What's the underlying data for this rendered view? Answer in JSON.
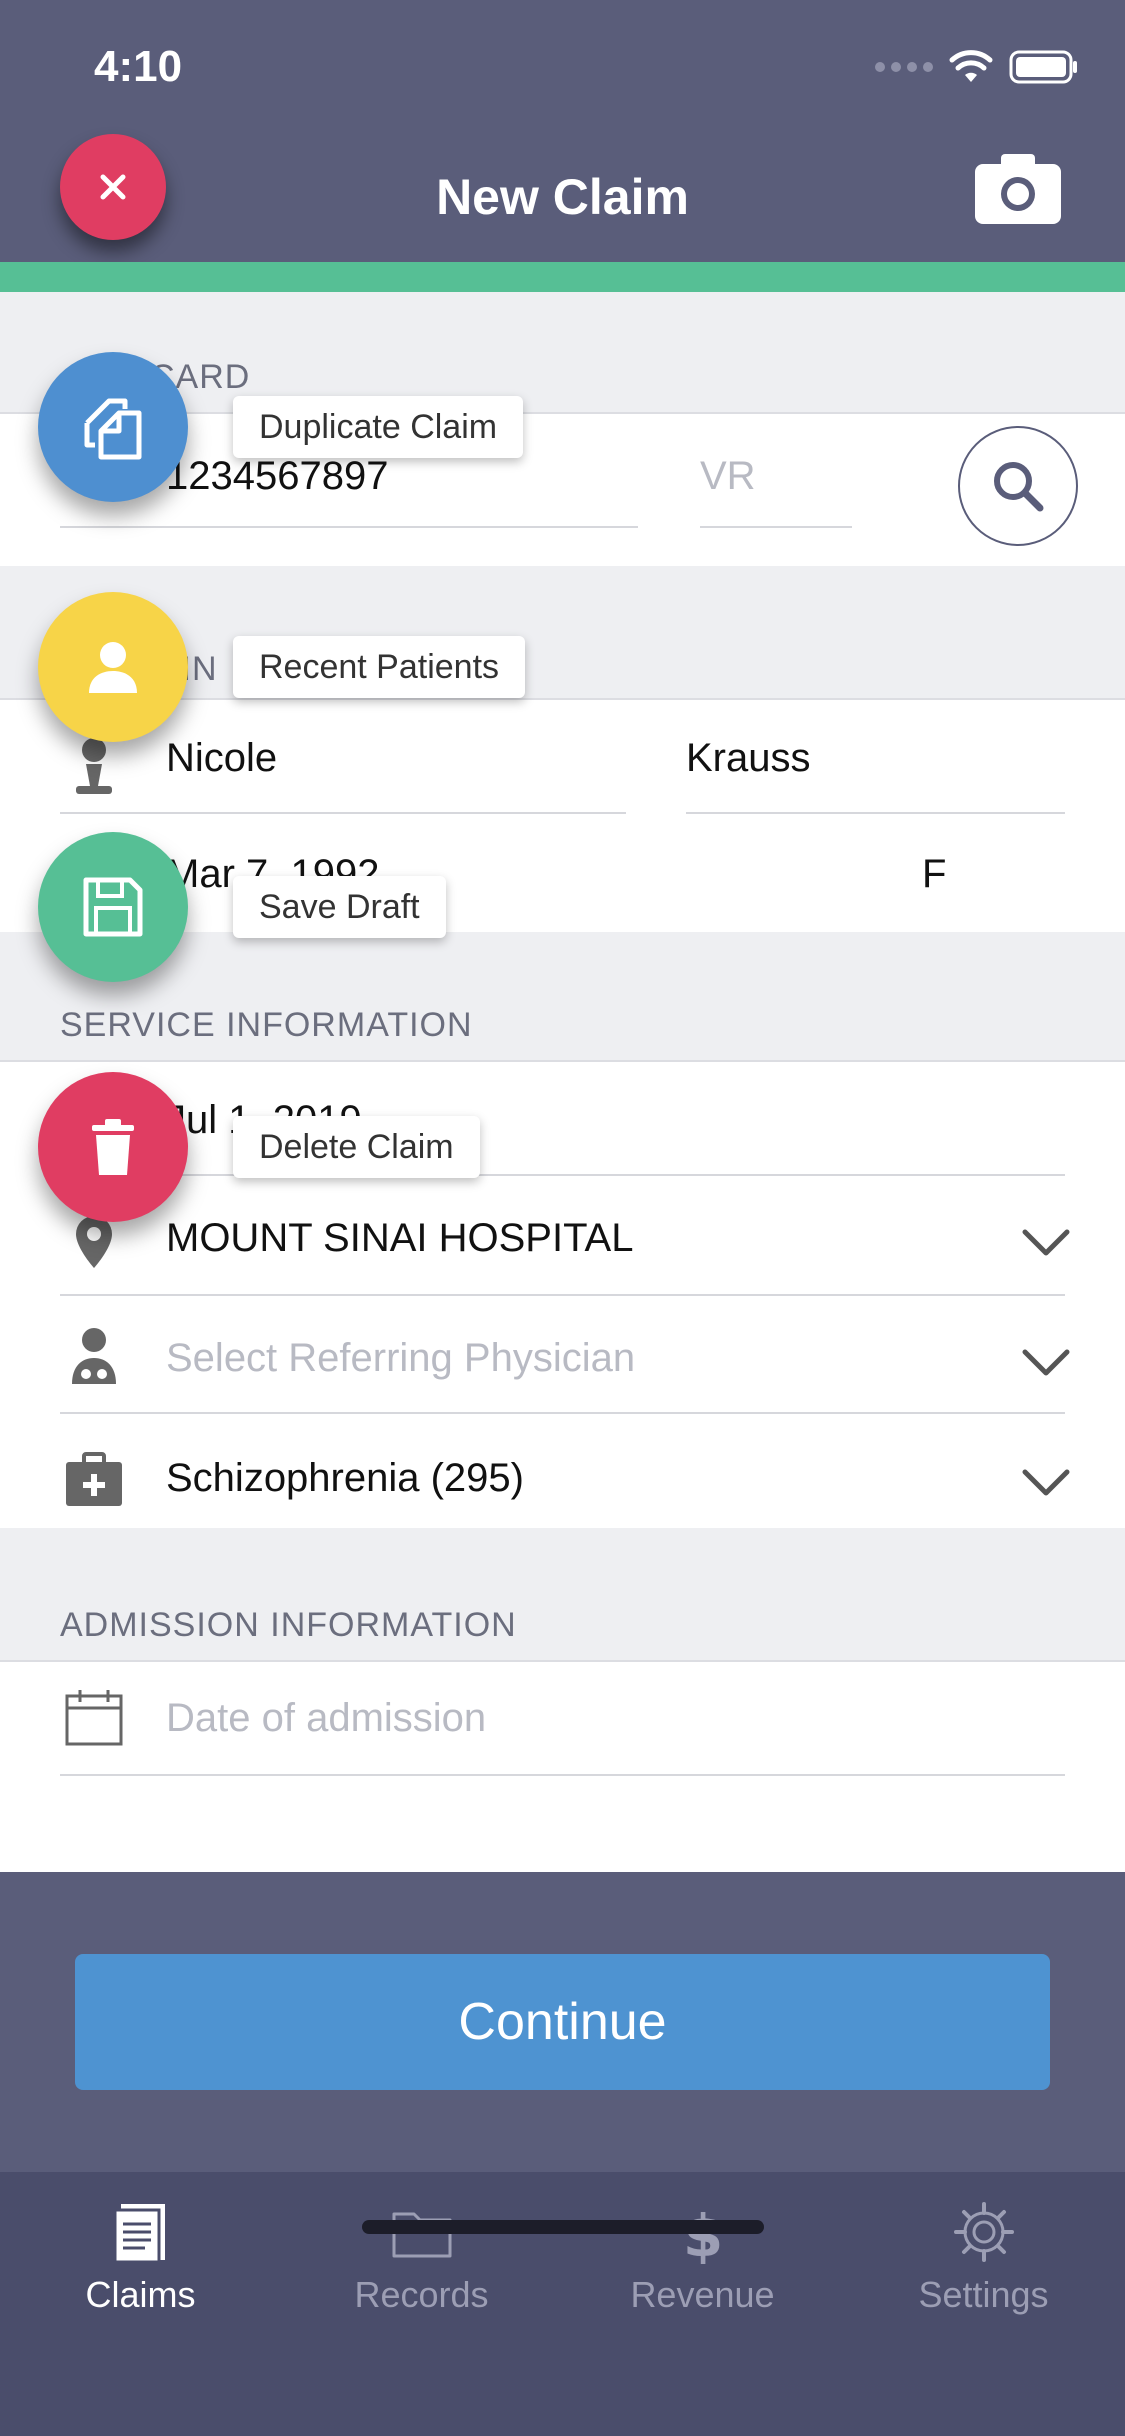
{
  "status": {
    "time": "4:10"
  },
  "header": {
    "title": "New Claim"
  },
  "health_card": {
    "section_label": "CARD",
    "number": "1234567897",
    "version_placeholder": "VR"
  },
  "patient": {
    "section_label": "T IN",
    "first_name": "Nicole",
    "last_name": "Krauss",
    "dob": "Mar 7, 1992",
    "sex": "F"
  },
  "service": {
    "section_label": "SERVICE INFORMATION",
    "date": "Jul 1, 2019",
    "location": "MOUNT SINAI HOSPITAL",
    "physician_placeholder": "Select Referring Physician",
    "diagnosis": "Schizophrenia (295)"
  },
  "admission": {
    "section_label": "ADMISSION INFORMATION",
    "date_placeholder": "Date of admission"
  },
  "fab_menu": {
    "duplicate_label": "Duplicate Claim",
    "recent_label": "Recent Patients",
    "save_label": "Save Draft",
    "delete_label": "Delete Claim",
    "colors": {
      "duplicate": "#4e8fd0",
      "recent": "#f7d448",
      "save": "#56bf95",
      "delete": "#e03d62"
    }
  },
  "actions": {
    "continue_label": "Continue"
  },
  "tabs": [
    {
      "label": "Claims",
      "icon": "document-icon",
      "active": true
    },
    {
      "label": "Records",
      "icon": "folder-icon",
      "active": false
    },
    {
      "label": "Revenue",
      "icon": "dollar-icon",
      "active": false
    },
    {
      "label": "Settings",
      "icon": "gear-icon",
      "active": false
    }
  ],
  "colors": {
    "header": "#5a5d7a",
    "accent": "#56bf95",
    "primary_button": "#4e93d1",
    "close": "#e03d62"
  }
}
